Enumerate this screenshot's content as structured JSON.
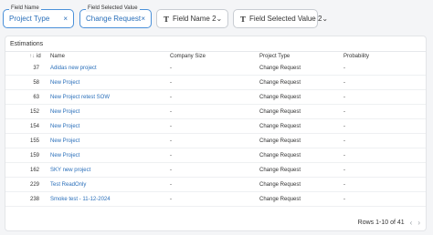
{
  "filters": {
    "field_name": {
      "legend": "Field Name",
      "value": "Project Type"
    },
    "field_selected_value": {
      "legend": "Field Selected Value",
      "value": "Change Request"
    },
    "field_name_2": {
      "label": "Field Name 2"
    },
    "field_selected_value_2": {
      "label": "Field Selected Value 2"
    },
    "close_glyph": "×",
    "chevron_glyph": "⌄",
    "type_glyph": "T"
  },
  "table": {
    "title": "Estimations",
    "sort_glyph": "↑↓",
    "columns": {
      "id": "id",
      "name": "Name",
      "company_size": "Company Size",
      "project_type": "Project Type",
      "probability": "Probability"
    },
    "rows": [
      {
        "id": "37",
        "name": "Adidas new project",
        "company_size": "-",
        "project_type": "Change Request",
        "probability": "-"
      },
      {
        "id": "58",
        "name": "New Project",
        "company_size": "-",
        "project_type": "Change Request",
        "probability": "-"
      },
      {
        "id": "63",
        "name": "New Project retest SOW",
        "company_size": "-",
        "project_type": "Change Request",
        "probability": "-"
      },
      {
        "id": "152",
        "name": "New Project",
        "company_size": "-",
        "project_type": "Change Request",
        "probability": "-"
      },
      {
        "id": "154",
        "name": "New Project",
        "company_size": "-",
        "project_type": "Change Request",
        "probability": "-"
      },
      {
        "id": "155",
        "name": "New Project",
        "company_size": "-",
        "project_type": "Change Request",
        "probability": "-"
      },
      {
        "id": "159",
        "name": "New Project",
        "company_size": "-",
        "project_type": "Change Request",
        "probability": "-"
      },
      {
        "id": "162",
        "name": "SKY new project",
        "company_size": "-",
        "project_type": "Change Request",
        "probability": "-"
      },
      {
        "id": "229",
        "name": "Test ReadOnly",
        "company_size": "-",
        "project_type": "Change Request",
        "probability": "-"
      },
      {
        "id": "238",
        "name": "Smoke test - 11-12-2024",
        "company_size": "-",
        "project_type": "Change Request",
        "probability": "-"
      }
    ]
  },
  "pager": {
    "text": "Rows 1-10 of 41",
    "prev_glyph": "‹",
    "next_glyph": "›"
  }
}
